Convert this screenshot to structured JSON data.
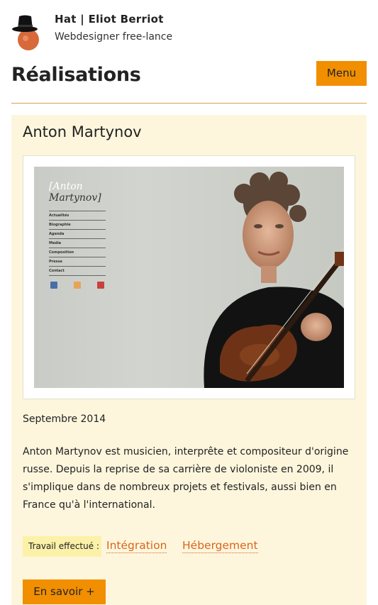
{
  "header": {
    "site_name": "Hat | Eliot Berriot",
    "tagline": "Webdesigner free-lance"
  },
  "page": {
    "title": "Réalisations",
    "menu_label": "Menu"
  },
  "project": {
    "title": "Anton Martynov",
    "date": "Septembre 2014",
    "description": "Anton Martynov est musicien, interprête et compositeur d'origine russe. Depuis la reprise de sa carrière de violoniste en 2009, il s'implique dans de nombreux projets et festivals, aussi bien en France qu'à l'international.",
    "work_label": "Travail effectué :",
    "work_tags": [
      "Intégration",
      "Hébergement"
    ],
    "more_label": "En savoir +",
    "screenshot": {
      "brand_line1": "[Anton",
      "brand_line2": "Martynov]",
      "nav": [
        "Actualités",
        "Biographie",
        "Agenda",
        "Media",
        "Composition",
        "Presse",
        "Contact"
      ],
      "social_icons": [
        "facebook-icon",
        "mail-icon",
        "youtube-icon"
      ]
    }
  },
  "colors": {
    "accent": "#f18f01",
    "card_bg": "#fdf6dd",
    "tag_color": "#d9651c",
    "label_bg": "#fcf1a8",
    "rule": "#d8a24a"
  }
}
